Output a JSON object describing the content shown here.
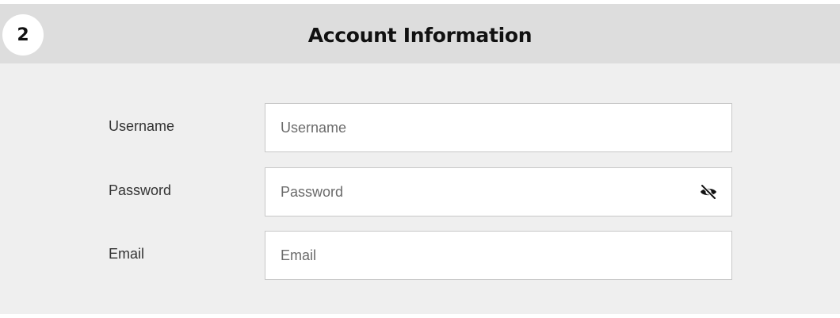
{
  "section": {
    "step_number": "2",
    "title": "Account Information"
  },
  "fields": {
    "username": {
      "label": "Username",
      "placeholder": "Username",
      "value": ""
    },
    "password": {
      "label": "Password",
      "placeholder": "Password",
      "value": "",
      "toggle_icon": "eye-slash-icon"
    },
    "email": {
      "label": "Email",
      "placeholder": "Email",
      "value": ""
    }
  },
  "colors": {
    "header_background": "#dddddd",
    "body_background": "#efefef",
    "input_border": "#c8c8c8",
    "text": "#111111"
  }
}
